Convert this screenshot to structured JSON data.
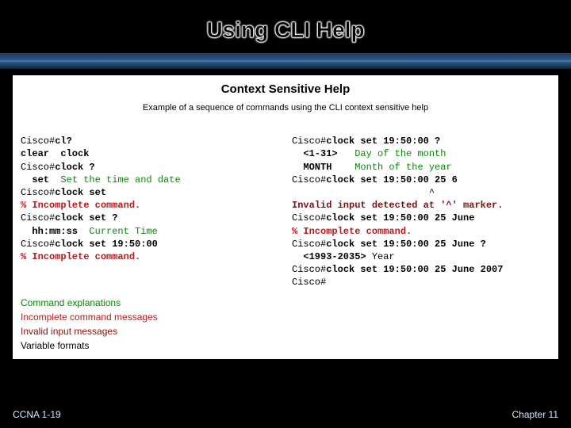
{
  "title": "Using CLI Help",
  "panel": {
    "heading": "Context Sensitive Help",
    "sub": "Example of a sequence of commands using the CLI context sensitive help"
  },
  "left": {
    "l1p": "Cisco#",
    "l1c": "cl?",
    "l2": "clear  clock",
    "l3p": "Cisco#",
    "l3c": "clock ?",
    "l4k": "  set",
    "l4d": "  Set the time and date",
    "l5p": "Cisco#",
    "l5c": "clock set",
    "l6": "% Incomplete command.",
    "l7p": "Cisco#",
    "l7c": "clock set ?",
    "l8k": "  hh:mm:ss",
    "l8d": "  Current Time",
    "l9p": "Cisco#",
    "l9c": "clock set 19:50:00",
    "l10": "% Incomplete command."
  },
  "right": {
    "r1p": "Cisco#",
    "r1c": "clock set 19:50:00 ?",
    "r2k": "  <1-31>",
    "r2d": "   Day of the month",
    "r3k": "  MONTH",
    "r3d": "    Month of the year",
    "r4p": "Cisco#",
    "r4c": "clock set 19:50:00 25 6",
    "r5": "                        ^",
    "r6": "Invalid input detected at '^' marker.",
    "r7p": "Cisco#",
    "r7c": "clock set 19:50:00 25 June",
    "r8": "% Incomplete command.",
    "r9p": "Cisco#",
    "r9c": "clock set 19:50:00 25 June ?",
    "r10k": "  <1993-2035>",
    "r10d": " Year",
    "r11p": "Cisco#",
    "r11c": "clock set 19:50:00 25 June 2007",
    "r12": "Cisco#"
  },
  "legend": {
    "a": "Command explanations",
    "b": "Incomplete command messages",
    "c": "Invalid input messages",
    "d": "Variable formats"
  },
  "footer": {
    "left": "CCNA 1-19",
    "right": "Chapter 11"
  }
}
